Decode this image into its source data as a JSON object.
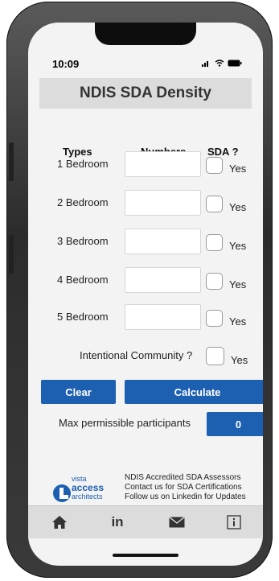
{
  "status": {
    "time": "10:09"
  },
  "app": {
    "title": "NDIS SDA Density"
  },
  "table": {
    "headers": {
      "types": "Types",
      "numbers": "Numbers",
      "sda": "SDA ?"
    },
    "rows": [
      {
        "label": "1 Bedroom",
        "value": "",
        "yes_label": "Yes",
        "sda_checked": false
      },
      {
        "label": "2 Bedroom",
        "value": "",
        "yes_label": "Yes",
        "sda_checked": false
      },
      {
        "label": "3 Bedroom",
        "value": "",
        "yes_label": "Yes",
        "sda_checked": false
      },
      {
        "label": "4 Bedroom",
        "value": "",
        "yes_label": "Yes",
        "sda_checked": false
      },
      {
        "label": "5 Bedroom",
        "value": "",
        "yes_label": "Yes",
        "sda_checked": false
      }
    ]
  },
  "community": {
    "label": "Intentional Community ?",
    "yes_label": "Yes",
    "checked": false
  },
  "buttons": {
    "clear": "Clear",
    "calculate": "Calculate"
  },
  "result": {
    "label": "Max permissible participants",
    "value": "0"
  },
  "footer": {
    "logo": {
      "word1": "vista",
      "word2": "access",
      "word3": "architects"
    },
    "lines": [
      "NDIS Accredited SDA Assessors",
      "Contact us for SDA Certifications",
      "Follow us on Linkedin for Updates"
    ]
  },
  "tabbar": {
    "items": [
      {
        "icon": "home-icon"
      },
      {
        "icon": "linkedin-icon",
        "text": "in"
      },
      {
        "icon": "mail-icon"
      },
      {
        "icon": "info-icon"
      }
    ]
  },
  "colors": {
    "accent": "#1d5fb0",
    "background": "#f3f3f3",
    "bar": "#dcdcdc"
  }
}
